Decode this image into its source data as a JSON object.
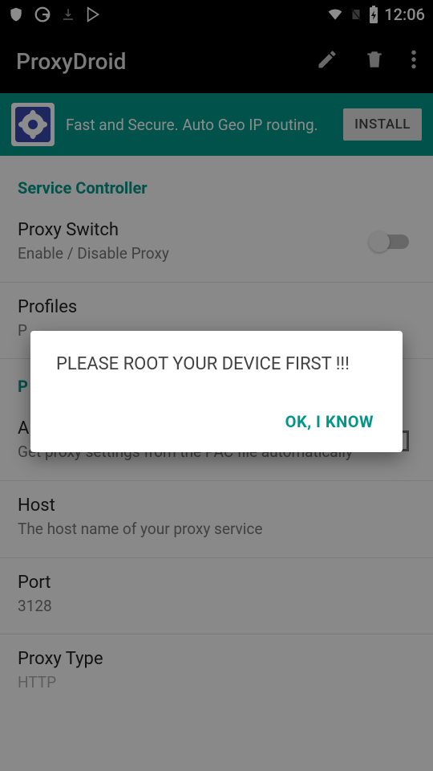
{
  "status": {
    "time": "12:06"
  },
  "appbar": {
    "title": "ProxyDroid"
  },
  "promo": {
    "text": "Fast and Secure. Auto Geo IP routing.",
    "install": "INSTALL"
  },
  "sections": {
    "service_controller": "Service Controller",
    "proxy_settings_partial": "P"
  },
  "prefs": {
    "proxy_switch": {
      "title": "Proxy Switch",
      "summary": "Enable / Disable Proxy"
    },
    "profiles": {
      "title": "Profiles",
      "summary_partial": "P"
    },
    "auto_pac": {
      "title_partial": "A",
      "summary": "Get proxy settings from the PAC file automatically"
    },
    "host": {
      "title": "Host",
      "summary": "The host name of your proxy service"
    },
    "port": {
      "title": "Port",
      "summary": "3128"
    },
    "proxy_type": {
      "title": "Proxy Type",
      "summary_partial": "HTTP"
    }
  },
  "dialog": {
    "message": "PLEASE ROOT YOUR DEVICE FIRST !!!",
    "ok": "OK, I KNOW"
  },
  "colors": {
    "accent": "#009688"
  }
}
